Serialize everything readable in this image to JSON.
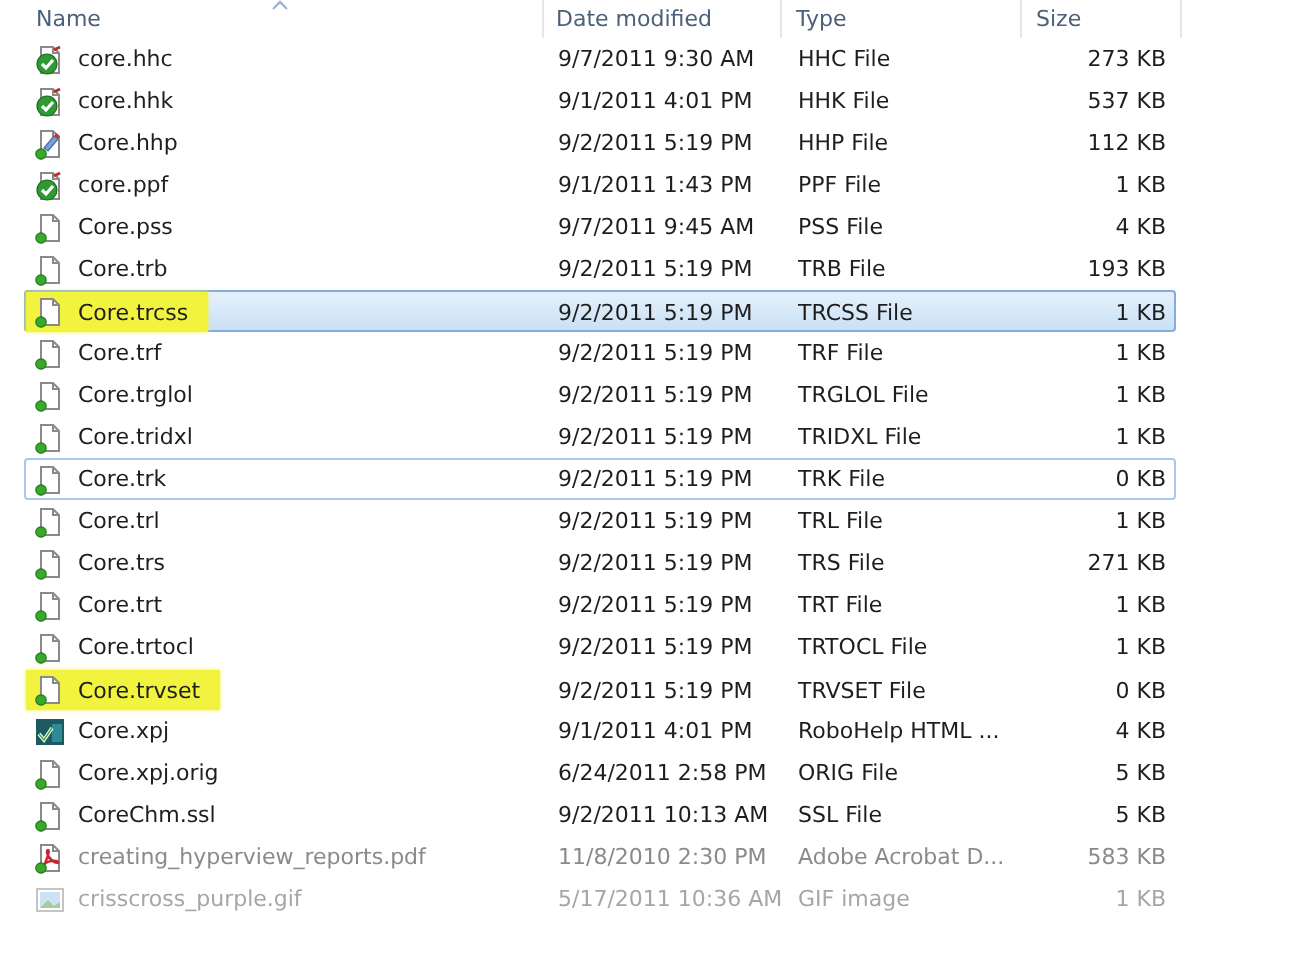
{
  "columns": [
    {
      "label": "Name",
      "sorted": true
    },
    {
      "label": "Date modified",
      "sorted": false
    },
    {
      "label": "Type",
      "sorted": false
    },
    {
      "label": "Size",
      "sorted": false
    }
  ],
  "rows": [
    {
      "kind": "check",
      "name": "core.hhc",
      "date": "9/7/2011 9:30 AM",
      "type": "HHC File",
      "size": "273 KB",
      "selected": false,
      "focused": false,
      "highlighted": false
    },
    {
      "kind": "check",
      "name": "core.hhk",
      "date": "9/1/2011 4:01 PM",
      "type": "HHK File",
      "size": "537 KB",
      "selected": false,
      "focused": false,
      "highlighted": false
    },
    {
      "kind": "hhp",
      "name": "Core.hhp",
      "date": "9/2/2011 5:19 PM",
      "type": "HHP File",
      "size": "112 KB",
      "selected": false,
      "focused": false,
      "highlighted": false
    },
    {
      "kind": "check",
      "name": "core.ppf",
      "date": "9/1/2011 1:43 PM",
      "type": "PPF File",
      "size": "1 KB",
      "selected": false,
      "focused": false,
      "highlighted": false
    },
    {
      "kind": "doc",
      "name": "Core.pss",
      "date": "9/7/2011 9:45 AM",
      "type": "PSS File",
      "size": "4 KB",
      "selected": false,
      "focused": false,
      "highlighted": false
    },
    {
      "kind": "doc",
      "name": "Core.trb",
      "date": "9/2/2011 5:19 PM",
      "type": "TRB File",
      "size": "193 KB",
      "selected": false,
      "focused": false,
      "highlighted": false
    },
    {
      "kind": "doc",
      "name": "Core.trcss",
      "date": "9/2/2011 5:19 PM",
      "type": "TRCSS File",
      "size": "1 KB",
      "selected": true,
      "focused": false,
      "highlighted": true
    },
    {
      "kind": "doc",
      "name": "Core.trf",
      "date": "9/2/2011 5:19 PM",
      "type": "TRF File",
      "size": "1 KB",
      "selected": false,
      "focused": false,
      "highlighted": false
    },
    {
      "kind": "doc",
      "name": "Core.trglol",
      "date": "9/2/2011 5:19 PM",
      "type": "TRGLOL File",
      "size": "1 KB",
      "selected": false,
      "focused": false,
      "highlighted": false
    },
    {
      "kind": "doc",
      "name": "Core.tridxl",
      "date": "9/2/2011 5:19 PM",
      "type": "TRIDXL File",
      "size": "1 KB",
      "selected": false,
      "focused": false,
      "highlighted": false
    },
    {
      "kind": "doc",
      "name": "Core.trk",
      "date": "9/2/2011 5:19 PM",
      "type": "TRK File",
      "size": "0 KB",
      "selected": false,
      "focused": true,
      "highlighted": false
    },
    {
      "kind": "doc",
      "name": "Core.trl",
      "date": "9/2/2011 5:19 PM",
      "type": "TRL File",
      "size": "1 KB",
      "selected": false,
      "focused": false,
      "highlighted": false
    },
    {
      "kind": "doc",
      "name": "Core.trs",
      "date": "9/2/2011 5:19 PM",
      "type": "TRS File",
      "size": "271 KB",
      "selected": false,
      "focused": false,
      "highlighted": false
    },
    {
      "kind": "doc",
      "name": "Core.trt",
      "date": "9/2/2011 5:19 PM",
      "type": "TRT File",
      "size": "1 KB",
      "selected": false,
      "focused": false,
      "highlighted": false
    },
    {
      "kind": "doc",
      "name": "Core.trtocl",
      "date": "9/2/2011 5:19 PM",
      "type": "TRTOCL File",
      "size": "1 KB",
      "selected": false,
      "focused": false,
      "highlighted": false
    },
    {
      "kind": "doc",
      "name": "Core.trvset",
      "date": "9/2/2011 5:19 PM",
      "type": "TRVSET File",
      "size": "0 KB",
      "selected": false,
      "focused": false,
      "highlighted": true
    },
    {
      "kind": "xpj",
      "name": "Core.xpj",
      "date": "9/1/2011 4:01 PM",
      "type": "RoboHelp HTML ...",
      "size": "4 KB",
      "selected": false,
      "focused": false,
      "highlighted": false
    },
    {
      "kind": "doc",
      "name": "Core.xpj.orig",
      "date": "6/24/2011 2:58 PM",
      "type": "ORIG File",
      "size": "5 KB",
      "selected": false,
      "focused": false,
      "highlighted": false
    },
    {
      "kind": "doc",
      "name": "CoreChm.ssl",
      "date": "9/2/2011 10:13 AM",
      "type": "SSL File",
      "size": "5 KB",
      "selected": false,
      "focused": false,
      "highlighted": false
    },
    {
      "kind": "pdf",
      "name": "creating_hyperview_reports.pdf",
      "date": "11/8/2010 2:30 PM",
      "type": "Adobe Acrobat D...",
      "size": "583 KB",
      "selected": false,
      "focused": false,
      "highlighted": false
    },
    {
      "kind": "gif",
      "name": "crisscross_purple.gif",
      "date": "5/17/2011 10:36 AM",
      "type": "GIF image",
      "size": "1 KB",
      "selected": false,
      "focused": false,
      "highlighted": false
    }
  ]
}
